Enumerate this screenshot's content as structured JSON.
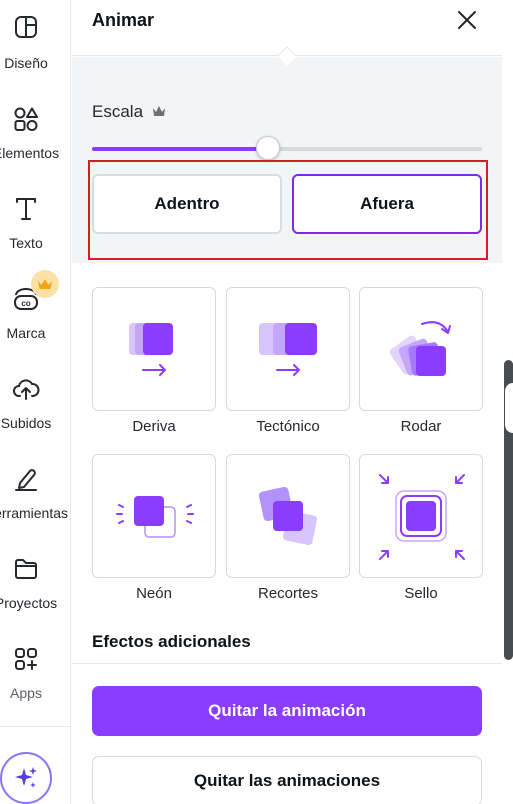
{
  "sidebar": {
    "items": [
      {
        "label": "Diseño",
        "icon": "layout-icon"
      },
      {
        "label": "Elementos",
        "icon": "shapes-icon"
      },
      {
        "label": "Texto",
        "icon": "text-icon"
      },
      {
        "label": "Marca",
        "icon": "brand-icon"
      },
      {
        "label": "Subidos",
        "icon": "cloud-upload-icon"
      },
      {
        "label": "Herramientas",
        "icon": "pen-tool-icon"
      },
      {
        "label": "Proyectos",
        "icon": "folder-icon"
      },
      {
        "label": "Apps",
        "icon": "apps-grid-icon"
      }
    ]
  },
  "panel": {
    "title": "Animar",
    "scale": {
      "label": "Escala",
      "value_fraction": 0.45
    },
    "direction": {
      "in_label": "Adentro",
      "out_label": "Afuera",
      "selected": "Afuera"
    },
    "effects": [
      {
        "name": "Deriva"
      },
      {
        "name": "Tectónico"
      },
      {
        "name": "Rodar"
      },
      {
        "name": "Neón"
      },
      {
        "name": "Recortes"
      },
      {
        "name": "Sello"
      }
    ],
    "section_title": "Efectos adicionales",
    "remove_button": "Quitar la animación",
    "remove_all_button": "Quitar las animaciones"
  },
  "colors": {
    "accent": "#8b3dff",
    "accent_dark": "#7d2ae8",
    "highlight": "#d21f26"
  }
}
